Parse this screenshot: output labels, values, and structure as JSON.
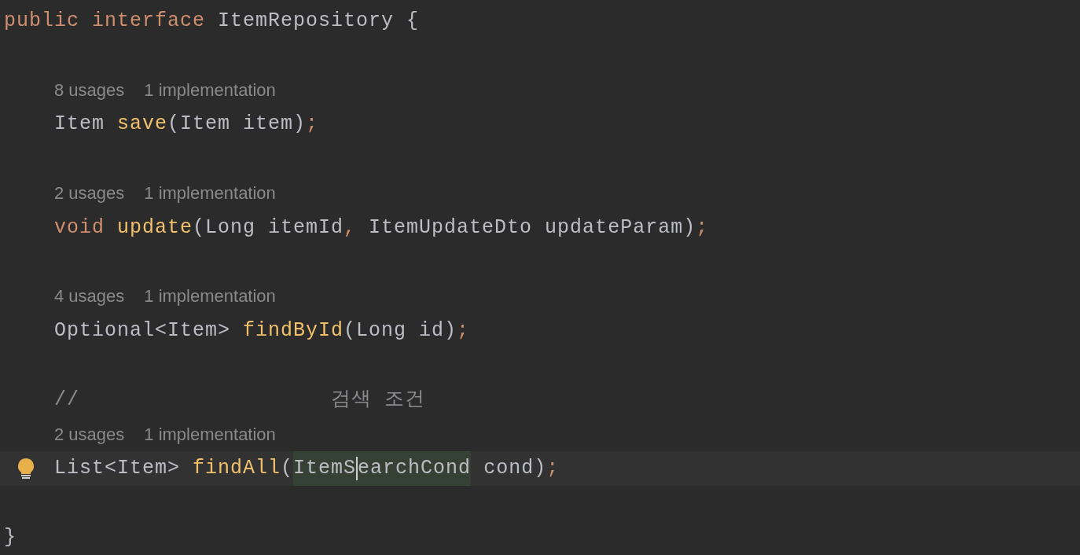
{
  "lines": [
    {
      "kind": "code",
      "current": false,
      "tokens": [
        {
          "text": "public ",
          "kind": "keyword"
        },
        {
          "text": "interface ",
          "kind": "keyword"
        },
        {
          "text": "ItemRepository {",
          "kind": "plain"
        }
      ],
      "children": [
        {
          "kind": "blank"
        },
        {
          "kind": "hints",
          "usages": "8 usages",
          "implementations": "1 implementation"
        },
        {
          "kind": "code",
          "current": false,
          "tokens": [
            {
              "text": "Item ",
              "kind": "plain"
            },
            {
              "text": "save",
              "kind": "method"
            },
            {
              "text": "(Item item)",
              "kind": "plain"
            },
            {
              "text": ";",
              "kind": "keyword"
            }
          ]
        },
        {
          "kind": "blank"
        },
        {
          "kind": "hints",
          "usages": "2 usages",
          "implementations": "1 implementation"
        },
        {
          "kind": "code",
          "current": false,
          "tokens": [
            {
              "text": "void ",
              "kind": "keyword"
            },
            {
              "text": "update",
              "kind": "method"
            },
            {
              "text": "(Long itemId",
              "kind": "plain"
            },
            {
              "text": ",",
              "kind": "keyword"
            },
            {
              "text": " ItemUpdateDto updateParam)",
              "kind": "plain"
            },
            {
              "text": ";",
              "kind": "keyword"
            }
          ]
        },
        {
          "kind": "blank"
        },
        {
          "kind": "hints",
          "usages": "4 usages",
          "implementations": "1 implementation"
        },
        {
          "kind": "code",
          "current": false,
          "tokens": [
            {
              "text": "Optional<Item> ",
              "kind": "plain"
            },
            {
              "text": "findById",
              "kind": "method"
            },
            {
              "text": "(Long id)",
              "kind": "plain"
            },
            {
              "text": ";",
              "kind": "keyword"
            }
          ]
        },
        {
          "kind": "blank"
        },
        {
          "kind": "code",
          "current": false,
          "tokens": [
            {
              "text": "//                    검색 조건",
              "kind": "comment"
            }
          ]
        },
        {
          "kind": "hints",
          "usages": "2 usages",
          "implementations": "1 implementation"
        },
        {
          "kind": "code",
          "current": true,
          "tokens": [
            {
              "text": "List<Item> ",
              "kind": "plain"
            },
            {
              "text": "findAll",
              "kind": "method"
            },
            {
              "text": "(",
              "kind": "plain"
            },
            {
              "text": "ItemS",
              "kind": "plain",
              "highlighted": true,
              "caret": true
            },
            {
              "text": "earchCond",
              "kind": "plain",
              "highlighted": true
            },
            {
              "text": " cond)",
              "kind": "plain"
            },
            {
              "text": ";",
              "kind": "keyword"
            }
          ]
        },
        {
          "kind": "blank"
        }
      ]
    },
    {
      "kind": "code",
      "current": false,
      "tokens": [
        {
          "text": "}",
          "kind": "plain"
        }
      ]
    }
  ]
}
